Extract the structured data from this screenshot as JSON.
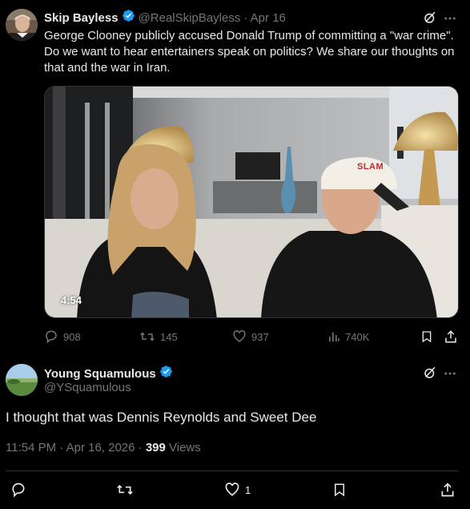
{
  "parent": {
    "name": "Skip Bayless",
    "handle": "@RealSkipBayless",
    "date": "· Apr 16",
    "text": "George Clooney publicly accused Donald Trump of committing a \"war crime\". Do we want to hear entertainers speak on politics? We share our thoughts on that and the war in Iran.",
    "video_duration": "4:54",
    "video_cap_text": "SLAM",
    "actions": {
      "replies": "908",
      "reposts": "145",
      "likes": "937",
      "views": "740K"
    }
  },
  "reply": {
    "name": "Young Squamulous",
    "handle": "@YSquamulous",
    "text": "I thought that was Dennis Reynolds and Sweet Dee",
    "time": "11:54 PM · Apr 16, 2026 · ",
    "views_count": "399",
    "views_label": " Views",
    "likes": "1"
  },
  "colors": {
    "background": "#000000",
    "text": "#e7e9ea",
    "muted": "#71767b",
    "verified": "#1d9bf0",
    "divider": "#2f3336"
  },
  "icons": [
    "grok-icon",
    "more-icon",
    "reply-icon",
    "repost-icon",
    "like-icon",
    "views-icon",
    "bookmark-icon",
    "share-icon",
    "verified-icon"
  ]
}
